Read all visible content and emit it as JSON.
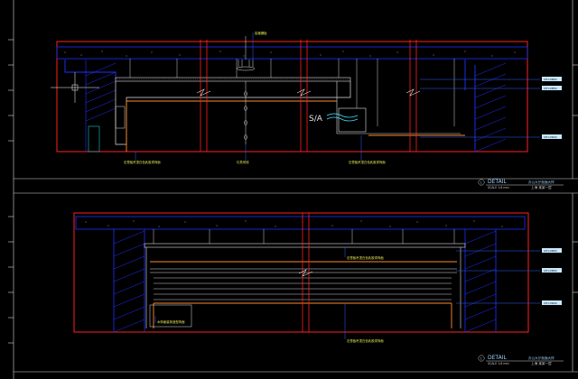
{
  "drawing": {
    "colors": {
      "background": "#000000",
      "frame": "#d8d8d8",
      "wall_outline": "#ff2020",
      "ceiling": "#2030ff",
      "leader": "#3060ff",
      "finish": "#ff8a2a",
      "structure": "#ff2020",
      "label_text": "#e8e85a",
      "tag_fill": "#c8e8ff"
    }
  },
  "upper": {
    "top_label": "铝格栅板",
    "bottom_labels": [
      "石膏板吊顶白色乳胶漆饰面",
      "灯具吊线",
      "石膏板吊顶白色乳胶漆饰面"
    ],
    "airflow_label": "S/A",
    "right_tags": [
      "CH=2850",
      "CH=2850",
      "CH=2600"
    ],
    "title_block": {
      "detail": "DETAIL",
      "number": "1",
      "scale": "SCALE 1:8    mm",
      "title": "办公大厅剖面大样",
      "subtitle": "上海 某某一层"
    }
  },
  "lower": {
    "top_label": "石膏板吊顶白色乳胶漆饰面",
    "mid_label": "木饰面装饰造型饰面",
    "bottom_label": "石膏板吊顶白色乳胶漆饰面",
    "right_tags": [
      "CH=2850",
      "CH=2800",
      "CH=2600"
    ],
    "title_block": {
      "detail": "DETAIL",
      "number": "1",
      "scale": "SCALE 1:8    mm",
      "title": "办公大厅剖面大样",
      "subtitle": "上海 某某一层"
    }
  }
}
